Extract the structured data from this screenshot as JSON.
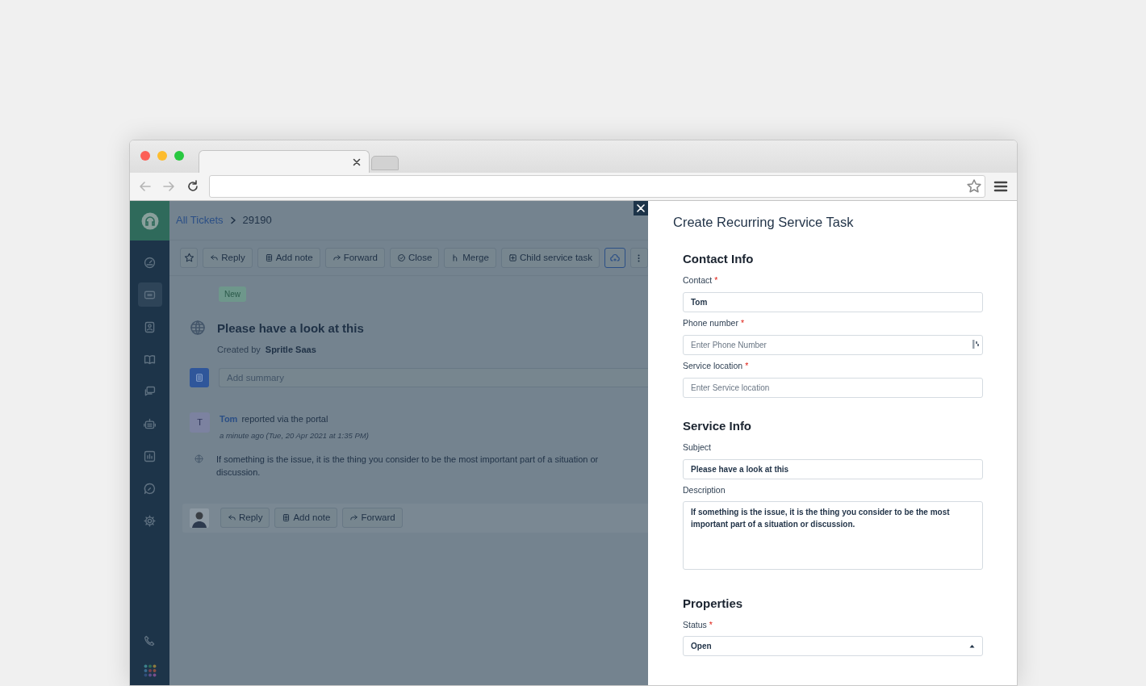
{
  "browser": {
    "tabs": [
      {
        "selected": true
      },
      {
        "selected": false
      }
    ]
  },
  "sidebar": {
    "items": [
      {
        "kind": "gauge",
        "selected": false
      },
      {
        "kind": "ticket",
        "selected": true
      },
      {
        "kind": "contact",
        "selected": false
      },
      {
        "kind": "book",
        "selected": false
      },
      {
        "kind": "chat",
        "selected": false
      },
      {
        "kind": "bot",
        "selected": false
      },
      {
        "kind": "chart",
        "selected": false
      },
      {
        "kind": "wrench",
        "selected": false
      },
      {
        "kind": "gear",
        "selected": false
      }
    ],
    "bottom_items": [
      {
        "kind": "phone"
      },
      {
        "kind": "apps"
      }
    ]
  },
  "breadcrumb": {
    "link": "All Tickets",
    "current": "29190"
  },
  "toolbar": [
    {
      "kind": "star"
    },
    {
      "kind": "button",
      "label": "Reply"
    },
    {
      "kind": "button",
      "label": "Add note"
    },
    {
      "kind": "button",
      "label": "Forward"
    },
    {
      "kind": "button",
      "label": "Close"
    },
    {
      "kind": "button",
      "label": "Merge"
    },
    {
      "kind": "button",
      "label": "Child service task"
    },
    {
      "kind": "toggle",
      "selected": true
    },
    {
      "kind": "more"
    }
  ],
  "ticket": {
    "status_badge": "New",
    "title": "Please have a look at this",
    "created_by_label": "Created by",
    "creator": "Spritle Saas",
    "summary_placeholder": "Add summary"
  },
  "activity": {
    "avatar_letter": "T",
    "author": "Tom",
    "action": "reported via the portal",
    "time": "a minute ago (Tue, 20 Apr 2021 at 1:35 PM)",
    "body": "If something is the issue, it is the thing you consider to be the most important part of a situation or discussion."
  },
  "reply_bar": {
    "buttons": [
      {
        "label": "Reply"
      },
      {
        "label": "Add note"
      },
      {
        "label": "Forward"
      }
    ]
  },
  "drawer": {
    "title": "Create Recurring Service Task",
    "required_mark": "*",
    "sections": [
      {
        "heading": "Contact Info",
        "fields": [
          {
            "kind": "input",
            "label": "Contact",
            "required": true,
            "value": "Tom"
          },
          {
            "kind": "phone",
            "label": "Phone number",
            "required": true,
            "placeholder": "Enter Phone Number"
          },
          {
            "kind": "input",
            "label": "Service location",
            "required": true,
            "placeholder": "Enter Service location"
          }
        ]
      },
      {
        "heading": "Service Info",
        "fields": [
          {
            "kind": "input",
            "label": "Subject",
            "required": false,
            "value": "Please have a look at this"
          },
          {
            "kind": "textarea",
            "label": "Description",
            "required": false,
            "value": "If something is the issue, it is the thing you consider to be the most important part of a situation or discussion."
          }
        ]
      },
      {
        "heading": "Properties",
        "fields": [
          {
            "kind": "select",
            "label": "Status",
            "required": true,
            "value": "Open"
          }
        ]
      }
    ]
  }
}
